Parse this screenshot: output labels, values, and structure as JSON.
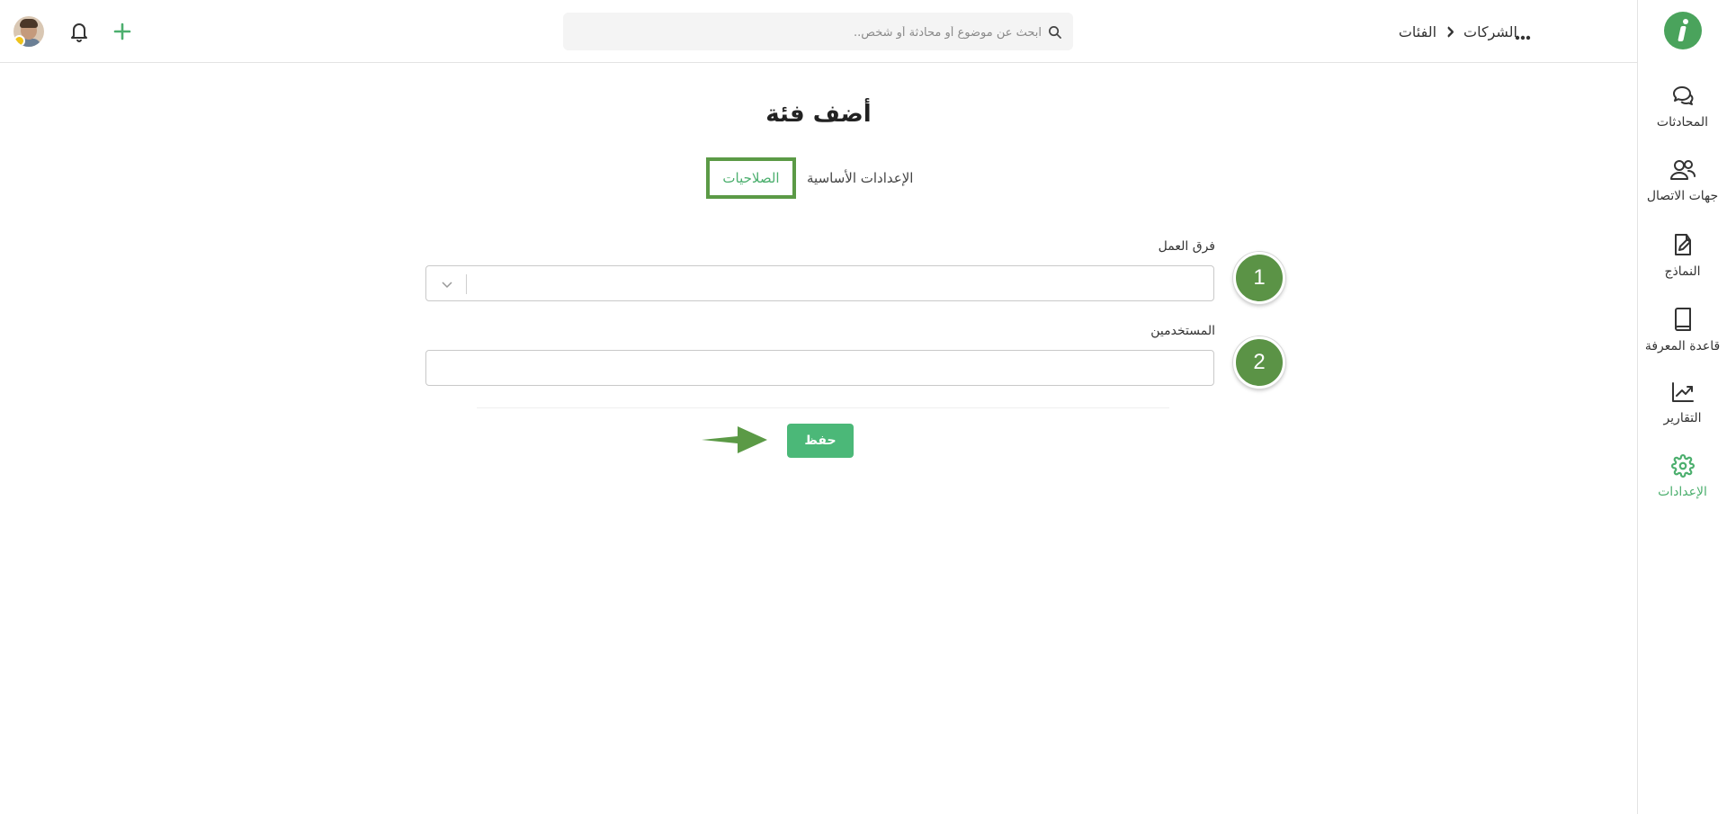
{
  "sidebar": {
    "items": [
      {
        "label": "المحادثات",
        "icon": "chat-bubbles-icon"
      },
      {
        "label": "جهات الاتصال",
        "icon": "contacts-icon"
      },
      {
        "label": "النماذج",
        "icon": "form-edit-icon"
      },
      {
        "label": "قاعدة المعرفة",
        "icon": "book-icon"
      },
      {
        "label": "التقارير",
        "icon": "chart-icon"
      },
      {
        "label": "الإعدادات",
        "icon": "gear-icon",
        "active": true
      }
    ]
  },
  "header": {
    "search_placeholder": "ابحث عن موضوع أو محادثة أو شخص..",
    "breadcrumb": [
      "الشركات",
      "الفئات"
    ]
  },
  "main": {
    "title": "أضف فئة",
    "tabs": [
      "الصلاحيات",
      "الإعدادات الأساسية"
    ],
    "fields": {
      "teams_label": "فرق العمل",
      "users_label": "المستخدمين"
    },
    "badges": [
      "1",
      "2"
    ],
    "save_label": "حفظ"
  },
  "colors": {
    "accent": "#4caf6e",
    "save_button": "#4bb878",
    "highlight": "#5b9a46",
    "badge": "#5b9346"
  }
}
